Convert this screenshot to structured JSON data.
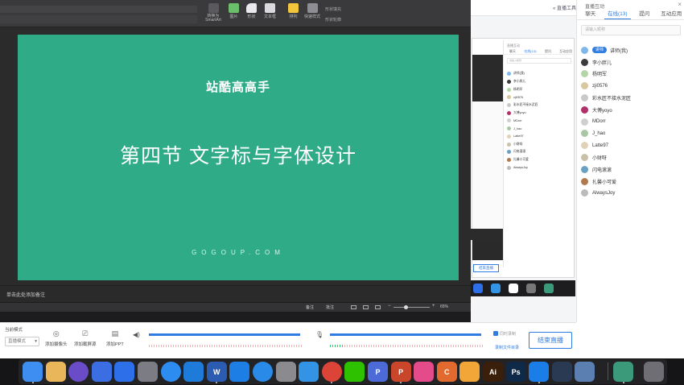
{
  "ppt": {
    "ribbon_labels": {
      "smartart": "转换为 SmartArt",
      "picture": "图片",
      "shape": "形状",
      "textbox": "文本框",
      "arrange": "排列",
      "quick_style": "快速样式",
      "shape_fill": "形状填充",
      "shape_outline": "形状轮廓"
    },
    "slide": {
      "brand": "站酷高高手",
      "title": "第四节   文字标与字体设计",
      "url": "GOGOUP.COM",
      "bg_color": "#2fac87"
    },
    "notes_placeholder": "单击此处添加备注",
    "status": {
      "notes": "备注",
      "comments": "批注",
      "zoom": "65%",
      "zoom_minus": "−",
      "zoom_plus": "+"
    }
  },
  "live_app": {
    "toolbox_link": "« 直播工具",
    "chat": {
      "title": "直播互动",
      "close": "×",
      "tabs": [
        "聊天",
        "在线(13)",
        "提问",
        "互动应用"
      ],
      "active_tab": 1,
      "search_placeholder": "请输入昵称",
      "lecturer_badge": "讲师",
      "users": [
        "讲师(我)",
        "李小胖儿",
        "杨明军",
        "zji0576",
        "彩水匠不接水泥匠",
        "大傅yoyo",
        "MDorr",
        "J_hao",
        "Latte97",
        "小财呀",
        "闪电滚滚",
        "扎馨小可爱",
        "AlwaysJoy"
      ]
    },
    "preview": {
      "title": "直播互动",
      "tabs": [
        "聊天",
        "在线(13)",
        "提问",
        "互动应用"
      ],
      "search_placeholder": "请输入昵称",
      "end_button": "结束直播"
    },
    "controls": {
      "mode_label": "当前模式",
      "mode_value": "直播模式",
      "mode_arrow": "▾",
      "buttons": [
        {
          "label": "添加摄像头",
          "icon": "camera-icon",
          "glyph": "◎"
        },
        {
          "label": "添加截屏源",
          "icon": "screen-icon",
          "glyph": "⎚"
        },
        {
          "label": "添加PPT",
          "icon": "ppt-file-icon",
          "glyph": "▤"
        }
      ],
      "speaker_glyph": "◀)",
      "mic_glyph": "🎙",
      "speaker_level": 1.0,
      "mic_level": 1.0,
      "record_label": "同时录制",
      "record_dir": "录制文件目录",
      "end_live": "结束直播"
    }
  },
  "dock": {
    "apps": [
      {
        "name": "finder",
        "color": "#3d8ef0",
        "glyph": ""
      },
      {
        "name": "notes",
        "color": "#e9b659",
        "glyph": ""
      },
      {
        "name": "siri",
        "color": "#6a4cc8",
        "glyph": ""
      },
      {
        "name": "chart-app",
        "color": "#3b6ee3",
        "glyph": ""
      },
      {
        "name": "shield-app",
        "color": "#2c6fe8",
        "glyph": ""
      },
      {
        "name": "launchpad",
        "color": "#7c7c84",
        "glyph": ""
      },
      {
        "name": "baidu-netdisk",
        "color": "#2d8cf0",
        "glyph": ""
      },
      {
        "name": "keynote",
        "color": "#1e7bd9",
        "glyph": ""
      },
      {
        "name": "word",
        "color": "#2b5cb2",
        "glyph": "W"
      },
      {
        "name": "cloud-app",
        "color": "#1d7ee5",
        "glyph": ""
      },
      {
        "name": "safari",
        "color": "#2a8ae8",
        "glyph": ""
      },
      {
        "name": "system-prefs",
        "color": "#8a8a8f",
        "glyph": ""
      },
      {
        "name": "paperplane",
        "color": "#3394e6",
        "glyph": ""
      },
      {
        "name": "chrome",
        "color": "#db4437",
        "glyph": ""
      },
      {
        "name": "wechat",
        "color": "#2dc100",
        "glyph": ""
      },
      {
        "name": "pp-app",
        "color": "#4d6bd8",
        "glyph": "P"
      },
      {
        "name": "powerpoint",
        "color": "#c9462a",
        "glyph": "P"
      },
      {
        "name": "qq-browser",
        "color": "#e34b8a",
        "glyph": ""
      },
      {
        "name": "c-app",
        "color": "#e36a2e",
        "glyph": "C"
      },
      {
        "name": "sketch",
        "color": "#f2a637",
        "glyph": ""
      },
      {
        "name": "illustrator",
        "color": "#3a1f0b",
        "glyph": "Ai"
      },
      {
        "name": "photoshop",
        "color": "#0f2a48",
        "glyph": "Ps"
      },
      {
        "name": "lanhu",
        "color": "#1a7de8",
        "glyph": ""
      },
      {
        "name": "steam",
        "color": "#2a3a52",
        "glyph": ""
      },
      {
        "name": "preview-app",
        "color": "#5b7fb0",
        "glyph": ""
      },
      {
        "name": "screen-app",
        "color": "#3b9a7a",
        "glyph": ""
      },
      {
        "name": "trash",
        "color": "#6e6e74",
        "glyph": ""
      }
    ]
  }
}
